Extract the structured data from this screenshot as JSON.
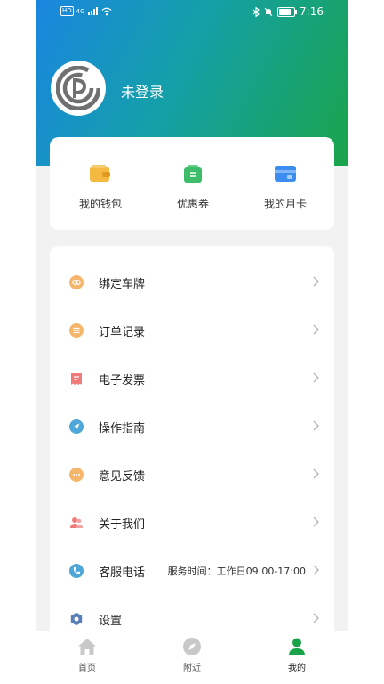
{
  "status_bar": {
    "network_badge": "HD",
    "signal_label": "4G",
    "time": "7:16",
    "battery_level": 0.8
  },
  "profile": {
    "name": "未登录",
    "avatar_icon": "parking-logo-icon"
  },
  "quick_actions": [
    {
      "label": "我的钱包",
      "icon": "wallet-icon",
      "color": "#f5b942"
    },
    {
      "label": "优惠券",
      "icon": "coupon-icon",
      "color": "#3dbd6a"
    },
    {
      "label": "我的月卡",
      "icon": "monthly-card-icon",
      "color": "#3b8ef0"
    }
  ],
  "menu": [
    {
      "label": "绑定车牌",
      "icon": "link-icon",
      "color": "#f5b56b",
      "extra": ""
    },
    {
      "label": "订单记录",
      "icon": "order-list-icon",
      "color": "#f5b56b",
      "extra": ""
    },
    {
      "label": "电子发票",
      "icon": "invoice-icon",
      "color": "#f07b7b",
      "extra": ""
    },
    {
      "label": "操作指南",
      "icon": "navigation-icon",
      "color": "#4fa6d8",
      "extra": ""
    },
    {
      "label": "意见反馈",
      "icon": "feedback-icon",
      "color": "#f5b56b",
      "extra": ""
    },
    {
      "label": "关于我们",
      "icon": "users-icon",
      "color": "#f07b7b",
      "extra": ""
    },
    {
      "label": "客服电话",
      "icon": "phone-icon",
      "color": "#4fa6d8",
      "extra": "服务时间：工作日09:00-17:00"
    },
    {
      "label": "设置",
      "icon": "gear-icon",
      "color": "#5a7fb8",
      "extra": ""
    }
  ],
  "bottom_nav": [
    {
      "label": "首页",
      "icon": "home-icon",
      "active": false
    },
    {
      "label": "附近",
      "icon": "compass-icon",
      "active": false
    },
    {
      "label": "我的",
      "icon": "person-icon",
      "active": true
    }
  ],
  "colors": {
    "gradient_start": "#1a86e0",
    "gradient_end": "#1aa44a",
    "active_nav": "#1aa44a",
    "inactive_nav": "#c8c8c8"
  }
}
